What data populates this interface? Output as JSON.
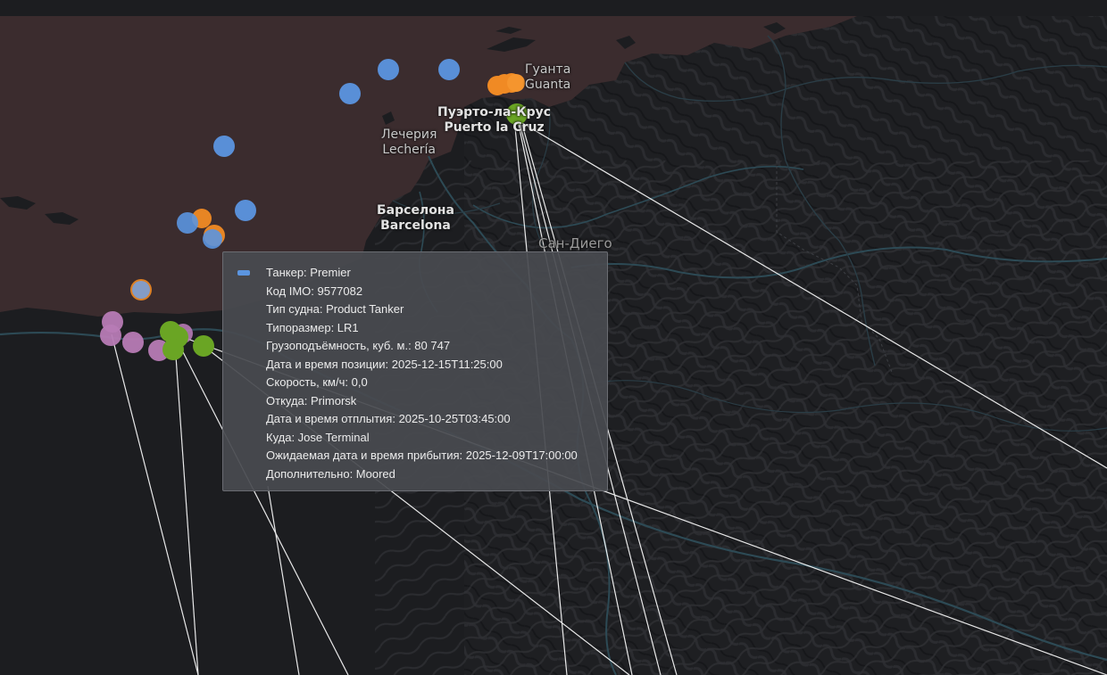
{
  "map": {
    "water_color": "#3b2c2e",
    "land_color": "#1c1d20",
    "route_line_color": "#ffffff",
    "labels": [
      {
        "id": "guanta",
        "lines": [
          "Гуанта",
          "Guanta"
        ]
      },
      {
        "id": "puerto-la-cruz",
        "lines": [
          "Пуэрто-ла-Крус",
          "Puerto la Cruz"
        ]
      },
      {
        "id": "lecheria",
        "lines": [
          "Лечерия",
          "Lechería"
        ]
      },
      {
        "id": "barcelona",
        "lines": [
          "Барселона",
          "Barcelona"
        ]
      },
      {
        "id": "san-diego",
        "lines": [
          "Сан-Диего"
        ]
      }
    ]
  },
  "vessel_categories": [
    {
      "name": "tanker",
      "color": "#5b95e0"
    },
    {
      "name": "orange-group",
      "color": "#f08a24"
    },
    {
      "name": "green-group",
      "color": "#6aa524"
    },
    {
      "name": "purple-group",
      "color": "#b77bb5"
    }
  ],
  "tooltip": {
    "marker_color": "#5b95e0",
    "rows": [
      "Танкер: Premier",
      "Код IMO: 9577082",
      "Тип судна: Product Tanker",
      "Типоразмер: LR1",
      "Грузоподъёмность, куб. м.: 80 747",
      "Дата и время позиции: 2025-12-15T11:25:00",
      "Скорость, км/ч: 0,0",
      "Откуда: Primorsk",
      "Дата и время отплытия: 2025-10-25T03:45:00",
      "Куда: Jose Terminal",
      "Ожидаемая дата и время прибытия: 2025-12-09T17:00:00",
      "Дополнительно: Moored"
    ]
  }
}
